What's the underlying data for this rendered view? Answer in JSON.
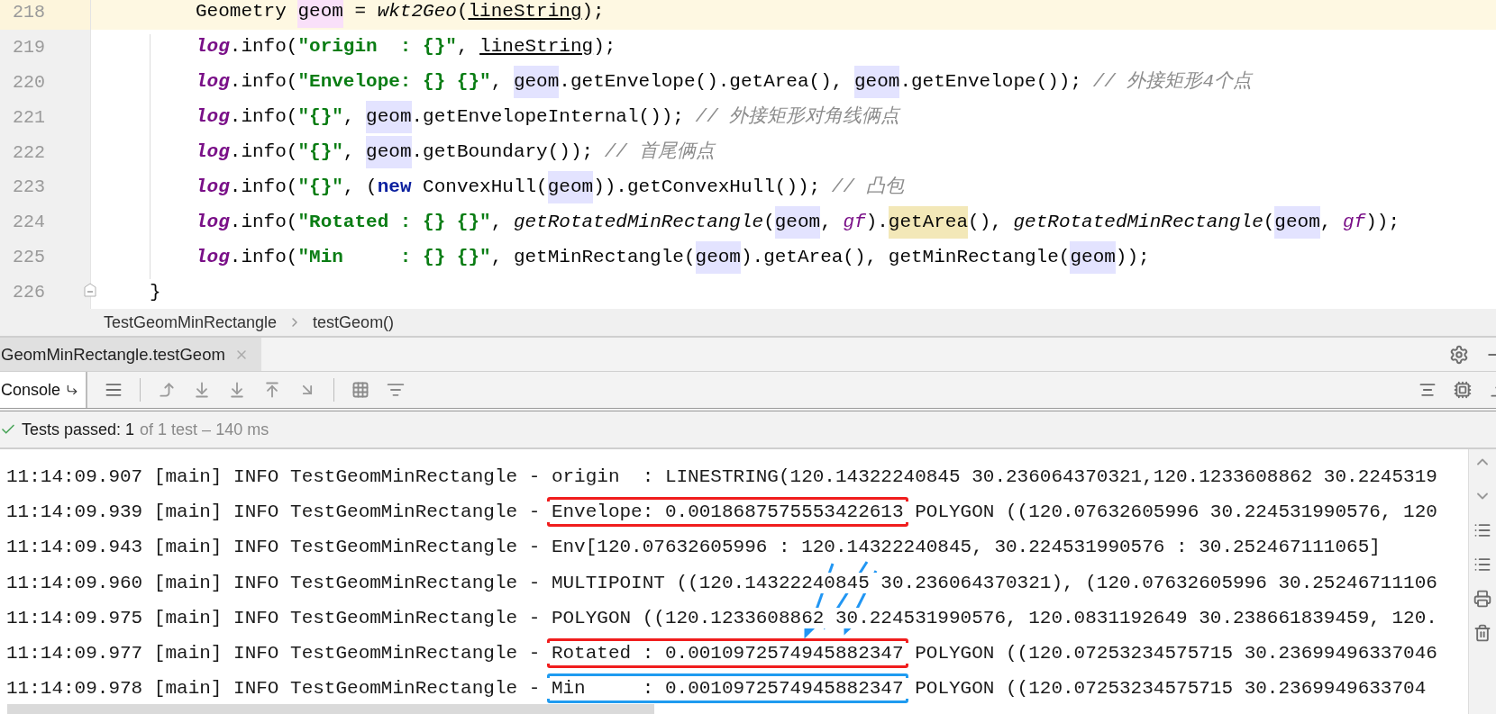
{
  "editor": {
    "lines": [
      {
        "number": "218",
        "current": true,
        "kind": "body",
        "tokens": [
          {
            "kind": "plain",
            "text": "Geometry "
          },
          {
            "kind": "decl",
            "text": "geom"
          },
          {
            "kind": "plain",
            "text": " = "
          },
          {
            "kind": "static",
            "text": "wkt2Geo"
          },
          {
            "kind": "plain",
            "text": "("
          },
          {
            "kind": "underline",
            "text": "lineString"
          },
          {
            "kind": "plain",
            "text": ");"
          }
        ]
      },
      {
        "number": "219",
        "current": false,
        "kind": "body",
        "tokens": [
          {
            "kind": "field",
            "text": "log"
          },
          {
            "kind": "plain",
            "text": ".info("
          },
          {
            "kind": "str",
            "text": "\"origin  : {}\""
          },
          {
            "kind": "plain",
            "text": ", "
          },
          {
            "kind": "underline",
            "text": "lineString"
          },
          {
            "kind": "plain",
            "text": ");"
          }
        ]
      },
      {
        "number": "220",
        "current": false,
        "kind": "body",
        "tokens": [
          {
            "kind": "field",
            "text": "log"
          },
          {
            "kind": "plain",
            "text": ".info("
          },
          {
            "kind": "str",
            "text": "\"Envelope: {} {}\""
          },
          {
            "kind": "plain",
            "text": ", "
          },
          {
            "kind": "ref",
            "text": "geom"
          },
          {
            "kind": "plain",
            "text": ".getEnvelope().getArea(), "
          },
          {
            "kind": "ref",
            "text": "geom"
          },
          {
            "kind": "plain",
            "text": ".getEnvelope()); "
          },
          {
            "kind": "comment",
            "text": "// 外接矩形4个点"
          }
        ]
      },
      {
        "number": "221",
        "current": false,
        "kind": "body",
        "tokens": [
          {
            "kind": "field",
            "text": "log"
          },
          {
            "kind": "plain",
            "text": ".info("
          },
          {
            "kind": "str",
            "text": "\"{}\""
          },
          {
            "kind": "plain",
            "text": ", "
          },
          {
            "kind": "ref",
            "text": "geom"
          },
          {
            "kind": "plain",
            "text": ".getEnvelopeInternal()); "
          },
          {
            "kind": "comment",
            "text": "// 外接矩形对角线俩点"
          }
        ]
      },
      {
        "number": "222",
        "current": false,
        "kind": "body",
        "tokens": [
          {
            "kind": "field",
            "text": "log"
          },
          {
            "kind": "plain",
            "text": ".info("
          },
          {
            "kind": "str",
            "text": "\"{}\""
          },
          {
            "kind": "plain",
            "text": ", "
          },
          {
            "kind": "ref",
            "text": "geom"
          },
          {
            "kind": "plain",
            "text": ".getBoundary()); "
          },
          {
            "kind": "comment",
            "text": "// 首尾俩点"
          }
        ]
      },
      {
        "number": "223",
        "current": false,
        "kind": "body",
        "tokens": [
          {
            "kind": "field",
            "text": "log"
          },
          {
            "kind": "plain",
            "text": ".info("
          },
          {
            "kind": "str",
            "text": "\"{}\""
          },
          {
            "kind": "plain",
            "text": ", ("
          },
          {
            "kind": "keyword",
            "text": "new"
          },
          {
            "kind": "plain",
            "text": " ConvexHull("
          },
          {
            "kind": "ref",
            "text": "geom"
          },
          {
            "kind": "plain",
            "text": ")).getConvexHull()); "
          },
          {
            "kind": "comment",
            "text": "// 凸包"
          }
        ]
      },
      {
        "number": "224",
        "current": false,
        "kind": "body",
        "tokens": [
          {
            "kind": "field",
            "text": "log"
          },
          {
            "kind": "plain",
            "text": ".info("
          },
          {
            "kind": "str",
            "text": "\"Rotated : {} {}\""
          },
          {
            "kind": "plain",
            "text": ", "
          },
          {
            "kind": "static",
            "text": "getRotatedMinRectangle"
          },
          {
            "kind": "plain",
            "text": "("
          },
          {
            "kind": "ref",
            "text": "geom"
          },
          {
            "kind": "plain",
            "text": ", "
          },
          {
            "kind": "param",
            "text": "gf"
          },
          {
            "kind": "plain",
            "text": ")."
          },
          {
            "kind": "match",
            "text": "getArea"
          },
          {
            "kind": "plain",
            "text": "(), "
          },
          {
            "kind": "static",
            "text": "getRotatedMinRectangle"
          },
          {
            "kind": "plain",
            "text": "("
          },
          {
            "kind": "ref",
            "text": "geom"
          },
          {
            "kind": "plain",
            "text": ", "
          },
          {
            "kind": "param",
            "text": "gf"
          },
          {
            "kind": "plain",
            "text": "));"
          }
        ]
      },
      {
        "number": "225",
        "current": false,
        "kind": "body",
        "tokens": [
          {
            "kind": "field",
            "text": "log"
          },
          {
            "kind": "plain",
            "text": ".info("
          },
          {
            "kind": "str",
            "text": "\"Min     : {} {}\""
          },
          {
            "kind": "plain",
            "text": ", getMinRectangle("
          },
          {
            "kind": "ref",
            "text": "geom"
          },
          {
            "kind": "plain",
            "text": ").getArea(), getMinRectangle("
          },
          {
            "kind": "ref",
            "text": "geom"
          },
          {
            "kind": "plain",
            "text": "));"
          }
        ]
      },
      {
        "number": "226",
        "current": false,
        "kind": "block_end",
        "tokens": [
          {
            "kind": "plain",
            "text": "}"
          }
        ]
      }
    ]
  },
  "breadcrumb": [
    "TestGeomMinRectangle",
    "testGeom()"
  ],
  "run_tab": {
    "label": "GeomMinRectangle.testGeom"
  },
  "console_tab": {
    "label": "Console",
    "selected": true
  },
  "test_status": {
    "passed": "Tests passed: 1",
    "detail": "of 1 test – 140 ms"
  },
  "console": {
    "lines": [
      {
        "text": "11:14:09.907 [main] INFO TestGeomMinRectangle - origin  : LINESTRING(120.14322240845 30.236064370321,120.1233608862 30.2245319"
      },
      {
        "prefix": "11:14:09.939 [main] INFO TestGeomMinRectangle - ",
        "marked": "Envelope: 0.0018687575553422613",
        "color": "#f01d1d",
        "rest": " POLYGON ((120.07632605996 30.224531990576, 120"
      },
      {
        "text": "11:14:09.943 [main] INFO TestGeomMinRectangle - Env[120.07632605996 : 120.14322240845, 30.224531990576 : 30.252467111065]"
      },
      {
        "text": "11:14:09.960 [main] INFO TestGeomMinRectangle - MULTIPOINT ((120.14322240845 30.236064370321), (120.07632605996 30.25246711106"
      },
      {
        "text": "11:14:09.975 [main] INFO TestGeomMinRectangle - POLYGON ((120.1233608862 30.224531990576, 120.0831192649 30.238661839459, 120."
      },
      {
        "prefix": "11:14:09.977 [main] INFO TestGeomMinRectangle - ",
        "marked": "Rotated : 0.0010972574945882347",
        "color": "#f01d1d",
        "rest": " POLYGON ((120.07253234575715 30.23699496337046"
      },
      {
        "prefix": "11:14:09.978 [main] INFO TestGeomMinRectangle - ",
        "marked": "Min     : 0.0010972574945882347",
        "color": "#1f9bf0",
        "rest": " POLYGON ((120.07253234575715 30.2369949633704"
      }
    ]
  }
}
